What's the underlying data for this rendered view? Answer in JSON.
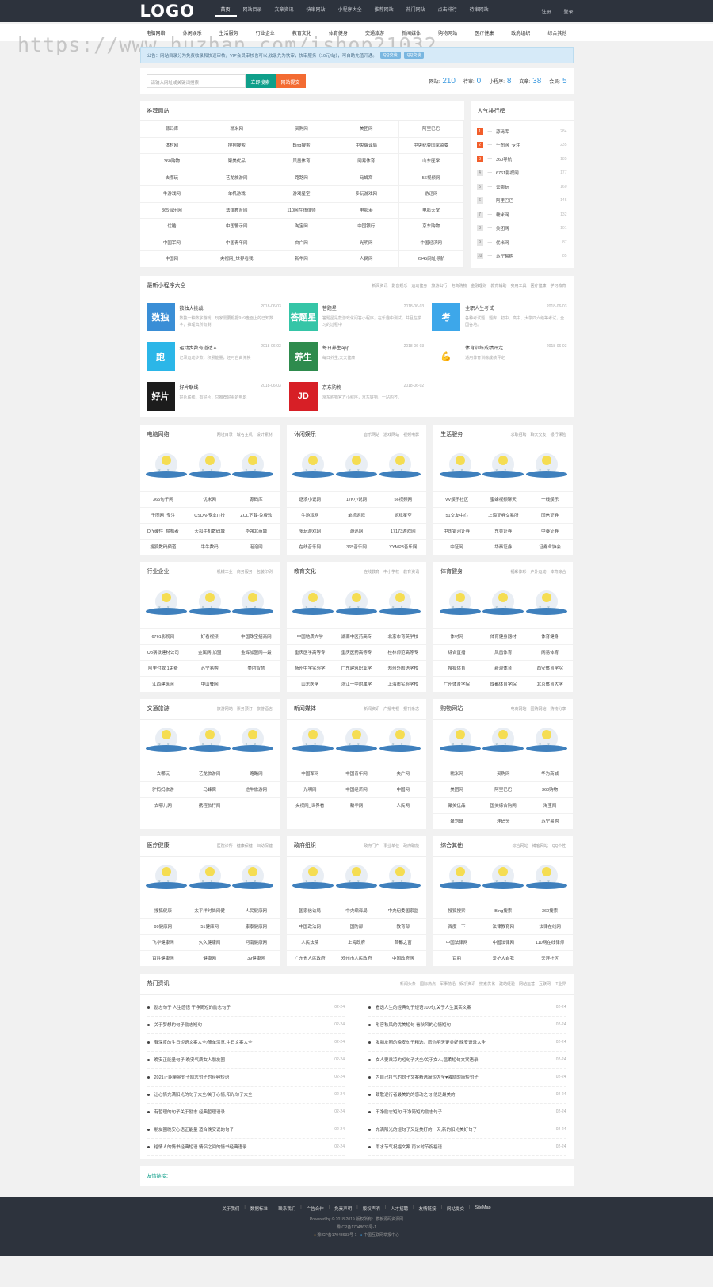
{
  "header": {
    "logo": "LOGO",
    "nav": [
      "首页",
      "网站目录",
      "文章资讯",
      "快审网站",
      "小程序大全",
      "推荐网站",
      "热门网站",
      "点击排行",
      "待审网站"
    ],
    "right": [
      "注册",
      "登录"
    ]
  },
  "watermark": "https://www.huzhan.com/ishop21032",
  "subnav": [
    "电脑网络",
    "休闲娱乐",
    "生活服务",
    "行业企业",
    "教育文化",
    "体育健身",
    "交通旅游",
    "新闻媒体",
    "购物网站",
    "医疗健康",
    "政府组织",
    "综合其他"
  ],
  "notice": {
    "text": "公告：网站目录分为免费收录和快速审核，VIP会员审核也可以,收录先为快审，快审服务（10元/站），可自助充值开通。",
    "qq1": "QQ交谈",
    "qq2": "QQ交谈"
  },
  "search": {
    "placeholder": "请输入网址或关键词搜索！",
    "btn": "立即搜索",
    "submit": "网站提交"
  },
  "stats": [
    {
      "label": "网站:",
      "value": "210"
    },
    {
      "label": "待审:",
      "value": "0"
    },
    {
      "label": "小程序:",
      "value": "8"
    },
    {
      "label": "文章:",
      "value": "38"
    },
    {
      "label": "会员:",
      "value": "5"
    }
  ],
  "recommend": {
    "title": "推荐网站",
    "sites": [
      "源码库",
      "糯米网",
      "买购网",
      "美团网",
      "阿里巴巴",
      "体材网",
      "搜狗搜索",
      "Bing搜索",
      "中央编译局",
      "中央纪委国家监委",
      "360购物",
      "聚美优品",
      "凤凰体育",
      "网易体育",
      "山东医学",
      "去哪玩",
      "艺龙旅游网",
      "路路网",
      "马蜂窝",
      "56视频网",
      "牛游戏网",
      "单机游戏",
      "游戏星空",
      "多玩游戏网",
      "游迅网",
      "365音乐网",
      "法律教育网",
      "110网在线律师",
      "电影港",
      "电影天堂",
      "优酷",
      "中国警示网",
      "淘宝网",
      "中国银行",
      "京东购物",
      "中国军网",
      "中国青年网",
      "央广网",
      "光明网",
      "中国经济网",
      "中国网",
      "央视网_世界看我",
      "新华网",
      "人民网",
      "2345网址导航"
    ]
  },
  "ranking": {
    "title": "人气排行榜",
    "items": [
      {
        "n": "1",
        "name": "源码库",
        "c": "284"
      },
      {
        "n": "2",
        "name": "千图网_专注",
        "c": "235"
      },
      {
        "n": "3",
        "name": "360导航",
        "c": "185"
      },
      {
        "n": "4",
        "name": "6761影视网",
        "c": "177"
      },
      {
        "n": "5",
        "name": "去哪玩",
        "c": "160"
      },
      {
        "n": "6",
        "name": "阿里巴巴",
        "c": "145"
      },
      {
        "n": "7",
        "name": "糯米网",
        "c": "132"
      },
      {
        "n": "8",
        "name": "美团网",
        "c": "101"
      },
      {
        "n": "9",
        "name": "优米网",
        "c": "87"
      },
      {
        "n": "10",
        "name": "苏宁易购",
        "c": "85"
      }
    ]
  },
  "miniapps": {
    "title": "最新小程序大全",
    "tags": [
      "新闻资讯",
      "影音娱乐",
      "运动健身",
      "旅游出行",
      "电商购物",
      "金融理财",
      "教育辅助",
      "实用工具",
      "医疗健康",
      "学习教育"
    ],
    "items": [
      {
        "name": "数独大挑战",
        "date": "2018-06-03",
        "desc": "数独一种数字游戏，玩家需要根据9×9盘面上的已知数字，推理出所有剩",
        "ic": "数独",
        "color": "#3a8ed6"
      },
      {
        "name": "答题星",
        "date": "2018-06-03",
        "desc": "答题星是款游戏化问答小程序，在乐趣中测试，并且在学习的过程中",
        "ic": "答题星",
        "color": "#35c5a7"
      },
      {
        "name": "全职人生考试",
        "date": "2018-06-03",
        "desc": "各种考试题、题库、初中、高中、大学四六级等考试，全国各地。",
        "ic": "考",
        "color": "#3da7ea"
      },
      {
        "name": "运动步数有道达人",
        "date": "2018-06-03",
        "desc": "记录运动步数，积累能量，还可自由兑换",
        "ic": "跑",
        "color": "#2bb6e8"
      },
      {
        "name": "每日养生app",
        "date": "2018-06-03",
        "desc": "每日养生,天天健康",
        "ic": "养生",
        "color": "#2e8b4d"
      },
      {
        "name": "体育训练成绩评定",
        "date": "2018-06-03",
        "desc": "通用体育训练成绩评定",
        "ic": "💪",
        "color": "#ffffff"
      },
      {
        "name": "好片联线",
        "date": "2018-06-03",
        "desc": "好片联线，有好片，只推荐好看的电影",
        "ic": "好片",
        "color": "#1c1c1c"
      },
      {
        "name": "京东购物",
        "date": "2018-06-02",
        "desc": "京东购物官方小程序，京东好物，一站购齐。",
        "ic": "JD",
        "color": "#d71f26"
      }
    ]
  },
  "categories": [
    {
      "title": "电脑网络",
      "tags": [
        "网址目录",
        "域名主机",
        "设计素材"
      ],
      "sites": [
        "365句子网",
        "优米网",
        "源码库",
        "千图网_专注",
        "CSDN-专业IT技",
        "ZOL下载-免费软",
        "DIY硬件_攒机者",
        "天和手机数码城",
        "华强北商城",
        "搜狐数码频道",
        "牛牛数码",
        "泡泡网"
      ]
    },
    {
      "title": "休闲娱乐",
      "tags": [
        "音乐网站",
        "游戏网站",
        "视频电影"
      ],
      "sites": [
        "逐浪小说网",
        "17K小说网",
        "56视频网",
        "牛游戏网",
        "单机游戏",
        "游戏星空",
        "多玩游戏网",
        "游迅网",
        "17173游戏网",
        "在线音乐网",
        "365音乐网",
        "YYMP3音乐网"
      ]
    },
    {
      "title": "生活服务",
      "tags": [
        "求职招聘",
        "聊天交友",
        "银行保险"
      ],
      "sites": [
        "VV娱乐社区",
        "蜜蜂视频聊天",
        "一线娱乐",
        "51交友中心",
        "上海证券交易所",
        "国信证券",
        "中国银河证券",
        "东莞证券",
        "中泰证券",
        "中证网",
        "华泰证券",
        "证券业协会"
      ]
    },
    {
      "title": "行业企业",
      "tags": [
        "机械工业",
        "商务服务",
        "包装印刷"
      ],
      "sites": [
        "6761影视网",
        "好看视频",
        "中国珠宝招商网",
        "U8钢铁建材公司",
        "金属网-加盟",
        "金辉加盟网—最",
        "阿里付款 1免费",
        "苏宁易购",
        "美团智慧",
        "江西建筑网",
        "中山餐网",
        ""
      ]
    },
    {
      "title": "教育文化",
      "tags": [
        "在线教育",
        "中小学校",
        "教育资讯"
      ],
      "sites": [
        "中国地质大学",
        "湖南中医药高专",
        "北京市育英学校",
        "重庆医学高等专",
        "重庆医药高等专",
        "桂林师范高等专",
        "扬州中学实验学",
        "广东建筑职业学",
        "郑州外国语学校",
        "山东医学",
        "浙江一中附属学",
        "上海市实验学校"
      ]
    },
    {
      "title": "体育健身",
      "tags": [
        "福彩体彩",
        "户外运动",
        "体育综合"
      ],
      "sites": [
        "体材网",
        "体育健身器材",
        "体育健身",
        "综合直播",
        "凤凰体育",
        "网易体育",
        "搜狐体育",
        "新浪体育",
        "西安体育学院",
        "广州体育学院",
        "成都体育学院",
        "北京体育大学"
      ]
    },
    {
      "title": "交通旅游",
      "tags": [
        "旅游网站",
        "票务预订",
        "旅游酒店"
      ],
      "sites": [
        "去哪玩",
        "艺龙旅游网",
        "路路网",
        "驴妈妈旅游",
        "马蜂窝",
        "途牛旅游网",
        "去哪儿网",
        "携程旅行网",
        ""
      ]
    },
    {
      "title": "新闻媒体",
      "tags": [
        "新闻资讯",
        "广播电视",
        "报刊杂志"
      ],
      "sites": [
        "中国军网",
        "中国青年网",
        "央广网",
        "光明网",
        "中国经济网",
        "中国网",
        "央视网_世界看",
        "新华网",
        "人民网"
      ]
    },
    {
      "title": "购物网站",
      "tags": [
        "电商网站",
        "团购网站",
        "购物分享"
      ],
      "sites": [
        "糯米网",
        "买购网",
        "华为商城",
        "美团网",
        "阿里巴巴",
        "360购物",
        "聚美优品",
        "国美综合购网",
        "淘宝网",
        "聚划算",
        "洋码头",
        "苏宁易购"
      ]
    },
    {
      "title": "医疗健康",
      "tags": [
        "医院诊所",
        "健康保健",
        "妇幼保健"
      ],
      "sites": [
        "搜狐健康",
        "太平洋时尚网健",
        "人民健康网",
        "99健康网",
        "51健康网",
        "康泰健康网",
        "飞华健康网",
        "久久健康网",
        "河南健康网",
        "百姓健康网",
        "健康网",
        "39健康网"
      ]
    },
    {
      "title": "政府组织",
      "tags": [
        "政府门户",
        "事业单位",
        "政府职能"
      ],
      "sites": [
        "国家信访局",
        "中央编译局",
        "中央纪委国家监",
        "中国政法网",
        "国防部",
        "教育部",
        "人民法院",
        "上海政府",
        "首都之窗",
        "广东省人民政府",
        "郑州市人民政府",
        "中国政府网"
      ]
    },
    {
      "title": "综合其他",
      "tags": [
        "综合网站",
        "博客网站",
        "QQ个性"
      ],
      "sites": [
        "搜狐搜索",
        "Bing搜索",
        "360搜索",
        "百度一下",
        "法律教育网",
        "法律在线网",
        "中国法律网",
        "中国法律网",
        "110网在线律师",
        "百朋",
        "爱护大自我",
        "天涯社区"
      ]
    }
  ],
  "news": {
    "title": "热门资讯",
    "tags": [
      "新闻头条",
      "国际热点",
      "军事前沿",
      "娱乐资讯",
      "搜索优化",
      "建站经验",
      "网站运营",
      "互联网",
      "IT业界"
    ],
    "left": [
      {
        "t": "励志句子 人生感悟 干净简短的励志句子",
        "d": "02-24"
      },
      {
        "t": "关于梦想的句子励志短句",
        "d": "02-24"
      },
      {
        "t": "有深度的生日短语文案大全/简单深意,生日文案大全",
        "d": "02-24"
      },
      {
        "t": "晚安正能量句子 晚安气质女人朋友圈",
        "d": "02-24"
      },
      {
        "t": "2021正能量金句子励志句子的经典短语",
        "d": "02-24"
      },
      {
        "t": "让心情充满阳光的句子大全/关于心情,阳光句子大全",
        "d": "02-24"
      },
      {
        "t": "有哲理的句子关于励志 经典哲理语录",
        "d": "02-24"
      },
      {
        "t": "朋友圈晚安心语正能量 适合晚安说的句子",
        "d": "02-24"
      },
      {
        "t": "给情人的情书经典短语 情侣之间的情书经典语录",
        "d": "02-24"
      }
    ],
    "right": [
      {
        "t": "看透人生的经典句子短语100句,关于人生真实文案",
        "d": "02-24"
      },
      {
        "t": "形容秋风的优美短句 看秋风的心情短句",
        "d": "02-24"
      },
      {
        "t": "发朋友圈的晚安句子精选，愿你明天更美好,晚安语录大全",
        "d": "02-24"
      },
      {
        "t": "女人要乘凉的短句子大全/关于女人,温柔短句文案语录",
        "d": "02-24"
      },
      {
        "t": "为自己打气的句子文案精选简短大全♥激励的简短句子",
        "d": "02-24"
      },
      {
        "t": "致敬逆行者最美的的感动之句,他是最美的",
        "d": "02-24"
      },
      {
        "t": "干净励志短句 干净简短的励志句子",
        "d": "02-24"
      },
      {
        "t": "充满阳光的短句子又是美好的一天,新的阳光美好句子",
        "d": "02-24"
      },
      {
        "t": "雨水节气祝福文案 雨水时节祝福语",
        "d": "02-24"
      }
    ]
  },
  "friend": "友情链接：",
  "footer": {
    "links": [
      "关于我们",
      "数据标准",
      "联系我们",
      "广告合作",
      "免责声明",
      "版权声明",
      "人才招聘",
      "友情链接",
      "网站提交",
      "SiteMap"
    ],
    "powered": "Powered by © 2018-2019 版权所有：模板源码资源网",
    "icp": "豫ICP备17048633号-1",
    "line3a": "豫ICP备17048633号-1",
    "line3b": "中国互联网举报中心"
  }
}
